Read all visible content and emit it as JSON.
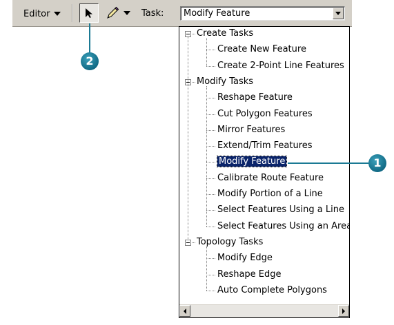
{
  "toolbar": {
    "editor_label": "Editor",
    "task_label": "Task:",
    "task_value": "Modify Feature"
  },
  "tree": {
    "groups": [
      {
        "label": "Create Tasks",
        "items": [
          "Create New Feature",
          "Create 2-Point Line Features"
        ]
      },
      {
        "label": "Modify Tasks",
        "items": [
          "Reshape Feature",
          "Cut Polygon Features",
          "Mirror Features",
          "Extend/Trim Features",
          "Modify Feature",
          "Calibrate Route Feature",
          "Modify Portion of a Line",
          "Select Features Using a Line",
          "Select Features Using an Area"
        ]
      },
      {
        "label": "Topology Tasks",
        "items": [
          "Modify Edge",
          "Reshape Edge",
          "Auto Complete Polygons"
        ]
      }
    ],
    "selected": "Modify Feature"
  },
  "callouts": {
    "one": "1",
    "two": "2"
  },
  "colors": {
    "callout": "#1b7a94",
    "selection": "#0a246a",
    "toolbar": "#d4d0c8"
  }
}
